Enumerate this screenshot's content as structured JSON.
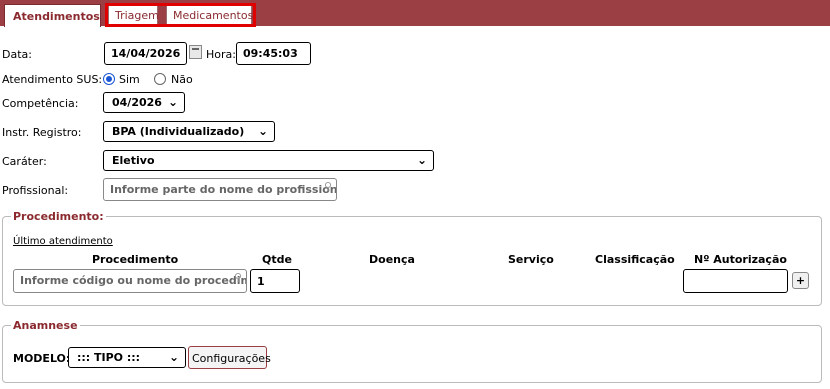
{
  "tabs": [
    {
      "label": "Atendimentos"
    },
    {
      "label": "Triagem"
    },
    {
      "label": "Medicamentos"
    }
  ],
  "form": {
    "data_label": "Data:",
    "data_value": "14/04/2026",
    "hora_label": "Hora:",
    "hora_value": "09:45:03",
    "sus_label": "Atendimento SUS:",
    "sus_yes": "Sim",
    "sus_no": "Não",
    "competencia_label": "Competência:",
    "competencia_value": "04/2026",
    "instr_label": "Instr. Registro:",
    "instr_value": "BPA (Individualizado)",
    "carater_label": "Caráter:",
    "carater_value": "Eletivo",
    "profissional_label": "Profissional:",
    "profissional_placeholder": "Informe parte do nome do profissional"
  },
  "procedimento": {
    "legend": "Procedimento:",
    "ultimo_link": "Último atendimento",
    "headers": [
      "Procedimento",
      "Qtde",
      "Doença",
      "Serviço",
      "Classificação",
      "Nº Autorização"
    ],
    "proc_placeholder": "Informe código ou nome do procedimento",
    "qtde_value": "1",
    "add_label": "+"
  },
  "anamnese": {
    "legend": "Anamnese",
    "modelo_label": "MODELO:",
    "tipo_value": "::: TIPO :::",
    "config_label": "Configurações"
  },
  "colors": {
    "brand": "#9b3f45",
    "accent": "#1a56d6",
    "highlight": "#e00000"
  }
}
